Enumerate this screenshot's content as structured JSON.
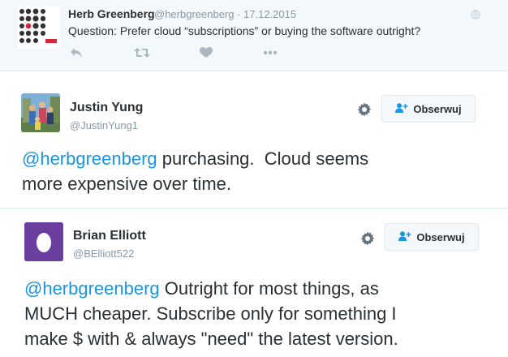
{
  "original_tweet": {
    "author_name": "Herb Greenberg",
    "meta": "@herbgreenberg · 17.12.2015",
    "text": "Question: Prefer cloud “subscriptions” or buying the software outright?",
    "actions": [
      "reply-icon",
      "retweet-icon",
      "like-icon",
      "more-icon"
    ]
  },
  "replies": [
    {
      "author_name": "Justin Yung",
      "handle": "@JustinYung1",
      "follow_label": "Obserwuj",
      "mention": "@herbgreenberg",
      "text_line1": " purchasing.  Cloud seems",
      "text_line2": "more expensive over time."
    },
    {
      "author_name": "Brian Elliott",
      "handle": "@BElliott522",
      "follow_label": "Obserwuj",
      "mention": "@herbgreenberg",
      "text_line1": " Outright for most things, as",
      "text_line2": "MUCH cheaper. Subscribe only for something I",
      "text_line3": "make $ with & always \"need\" the latest version."
    }
  ],
  "colors": {
    "mention": "#1b95e0",
    "muted": "#8899a6",
    "egg_avatar": "#6b3fa0",
    "icon_grey": "#aab8c2"
  }
}
